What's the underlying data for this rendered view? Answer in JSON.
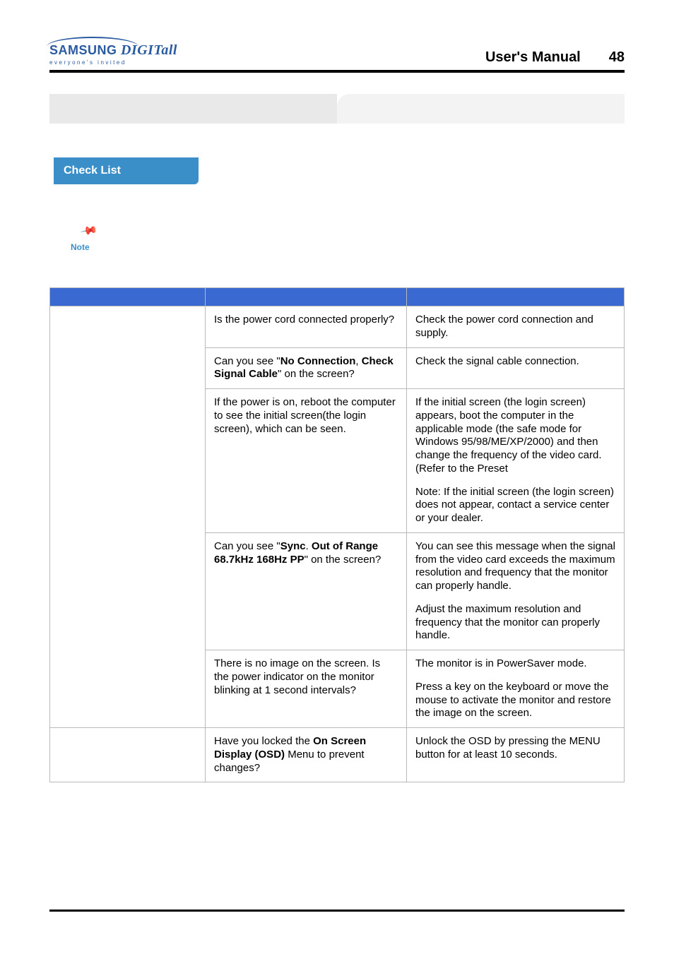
{
  "header": {
    "logo_main_a": "SAMSUNG",
    "logo_main_b": " DIGIT",
    "logo_main_c": "all",
    "logo_sub": "everyone's invited",
    "manual_title": "User's Manual",
    "page_number": "48"
  },
  "section": {
    "checklist_label": "Check List",
    "note_label": "Note"
  },
  "table": {
    "rows": [
      {
        "check": "Is the power cord connected properly?",
        "solution": "Check the power cord connection and supply."
      },
      {
        "check_pre": "Can you see \"",
        "check_b1": "No Connection",
        "check_mid": ", ",
        "check_b2": "Check Signal Cable",
        "check_post": "\" on the screen?",
        "solution": "Check the signal cable connection."
      },
      {
        "check": "If the power is on, reboot the computer to see the initial screen(the login screen), which can be seen.",
        "solution_p1": "If the initial screen (the login screen) appears, boot the computer in the applicable mode (the safe mode for Windows 95/98/ME/XP/2000) and then change the frequency of the video card. (Refer to the Preset",
        "solution_p2": "Note: If the initial screen (the login screen) does not appear, contact a service center or your dealer."
      },
      {
        "check_pre": "Can you see \"",
        "check_b1": "Sync",
        "check_mid": ". ",
        "check_b2": "Out of Range 68.7kHz 168Hz PP",
        "check_post": "\" on the screen?",
        "solution_p1": "You can see this message when the signal from the video card exceeds the maximum resolution and frequency that the monitor can properly handle.",
        "solution_p2": "Adjust the maximum resolution and frequency that the monitor can properly handle."
      },
      {
        "check": "There is no image on the screen. Is the power indicator on the monitor blinking at 1 second intervals?",
        "solution_p1": "The monitor is in PowerSaver mode.",
        "solution_p2": "Press a key on the keyboard or move the mouse to activate the monitor and restore the image on the screen."
      },
      {
        "check_pre": "Have you locked the ",
        "check_b1": "On Screen Display (OSD)",
        "check_post": " Menu to prevent changes?",
        "solution": "Unlock the OSD by pressing the MENU button for at least 10 seconds."
      }
    ]
  }
}
